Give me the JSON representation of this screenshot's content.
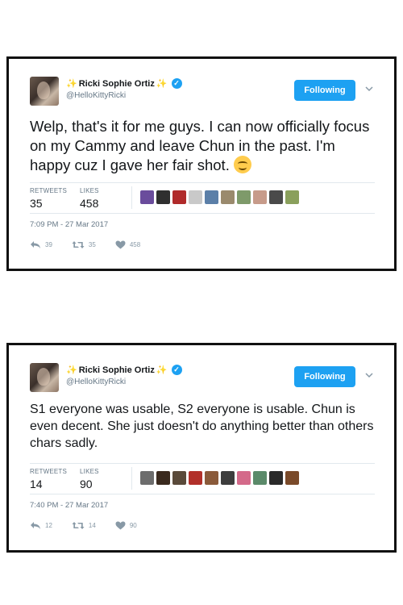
{
  "tweets": [
    {
      "display_name": "Ricki Sophie Ortiz",
      "name_prefix": "✨",
      "name_suffix": "✨",
      "handle": "@HelloKittyRicki",
      "follow_label": "Following",
      "text": "Welp, that's it for me guys. I can now officially focus on my Cammy and leave Chun in the past. I'm happy cuz I gave her fair shot.",
      "retweets_label": "RETWEETS",
      "retweets": "35",
      "likes_label": "LIKES",
      "likes": "458",
      "timestamp": "7:09 PM - 27 Mar 2017",
      "reply_count": "39",
      "retweet_count": "35",
      "like_count": "458",
      "liker_colors": [
        "#6a4c9c",
        "#2f2f2f",
        "#b02a2a",
        "#c9c9c9",
        "#5b7fa8",
        "#9a8a6d",
        "#7e9a6a",
        "#c79b8a",
        "#4a4a4a",
        "#8aa05c"
      ]
    },
    {
      "display_name": "Ricki Sophie Ortiz",
      "name_prefix": "✨",
      "name_suffix": "✨",
      "handle": "@HelloKittyRicki",
      "follow_label": "Following",
      "text": "S1 everyone was usable, S2 everyone is usable. Chun is even decent. She just doesn't do anything better than others chars sadly.",
      "retweets_label": "RETWEETS",
      "retweets": "14",
      "likes_label": "LIKES",
      "likes": "90",
      "timestamp": "7:40 PM - 27 Mar 2017",
      "reply_count": "12",
      "retweet_count": "14",
      "like_count": "90",
      "liker_colors": [
        "#6d6d6d",
        "#3a2a1e",
        "#5a4a3a",
        "#b2302a",
        "#8a5a3a",
        "#3d3d3d",
        "#d46a8a",
        "#5b8a6a",
        "#2a2a2a",
        "#7a4a2a"
      ]
    }
  ],
  "colors": {
    "accent": "#1da1f2",
    "secondary_text": "#657786",
    "icon_gray": "#8899a6",
    "divider": "#e1e8ed",
    "verified_badge": "#1da1f2"
  },
  "icons": {
    "verified": "verified-badge-icon",
    "caret": "chevron-down-icon",
    "reply": "reply-icon",
    "retweet": "retweet-icon",
    "like": "heart-icon",
    "emoji": "smiling-face-emoji"
  }
}
